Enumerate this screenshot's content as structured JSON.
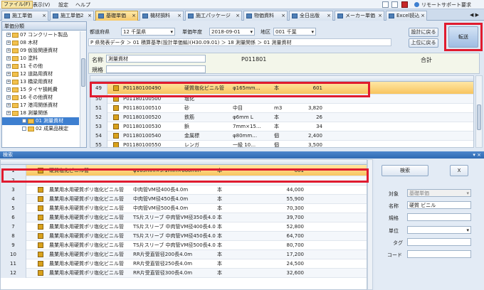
{
  "menu": {
    "file": "ファイル(F)",
    "view": "表示(V)",
    "settings": "設定",
    "help": "ヘルプ",
    "support": "リモートサポート要求"
  },
  "tabs": [
    "施工単価",
    "施工単価2",
    "基礎単価",
    "機材損料",
    "施工パッケージ",
    "物価資料",
    "全日出版",
    "メーカー単価",
    "Excel読込"
  ],
  "tab_close": "×",
  "tree": {
    "header": "単価分類",
    "items": [
      {
        "label": "07 コンクリート製品",
        "indent": 1
      },
      {
        "label": "08 木材",
        "indent": 1
      },
      {
        "label": "09 仮設関連資材",
        "indent": 1
      },
      {
        "label": "10 塗料",
        "indent": 1
      },
      {
        "label": "11 その他",
        "indent": 1
      },
      {
        "label": "12 道路用資材",
        "indent": 1
      },
      {
        "label": "13 橋梁用資材",
        "indent": 1
      },
      {
        "label": "15 タイヤ損耗費",
        "indent": 1
      },
      {
        "label": "16 その他資材",
        "indent": 1
      },
      {
        "label": "17 港湾関係資材",
        "indent": 1
      },
      {
        "label": "18 測量関係",
        "indent": 1
      },
      {
        "label": "01 測量資材",
        "indent": 2
      },
      {
        "label": "02 成果品検定",
        "indent": 2
      }
    ]
  },
  "filter": {
    "pref_label": "都道府県",
    "pref_value": "12 千葉県",
    "year_label": "単価年度",
    "year_value": "2018-09-01",
    "area_label": "地区",
    "area_value": "001 千葉",
    "path": "P 県発表データ ＞ 01 積算基準(設計単価編)(H30.09.01) ＞ 18 測量関係 ＞ 01 測量資材",
    "btn_settings_back": "設計に戻る",
    "btn_up": "上位に戻る",
    "btn_transfer": "転送"
  },
  "info": {
    "name_label": "名称",
    "name_value": "測量資材",
    "code": "P011801",
    "spec_label": "規格",
    "total_label": "合計"
  },
  "top_rows": [
    {
      "n": "49",
      "code": "P01180100490",
      "name": "硬質塩化ビニル管",
      "spec": "φ165mm…",
      "unit": "本",
      "price": "601"
    },
    {
      "n": "50",
      "code": "P01180100500",
      "name": "塩化",
      "spec": "",
      "unit": "",
      "price": ""
    },
    {
      "n": "51",
      "code": "P01180100510",
      "name": "砂",
      "spec": "中目",
      "unit": "m3",
      "price": "3,820"
    },
    {
      "n": "52",
      "code": "P01180100520",
      "name": "鉄筋",
      "spec": "φ6mm L",
      "unit": "本",
      "price": "26"
    },
    {
      "n": "53",
      "code": "P01180100530",
      "name": "鋲",
      "spec": "7mm×15…",
      "unit": "本",
      "price": "34"
    },
    {
      "n": "54",
      "code": "P01180100540",
      "name": "金属標",
      "spec": "φ80mm…",
      "unit": "個",
      "price": "2,400"
    },
    {
      "n": "55",
      "code": "P01180100550",
      "name": "レンガ",
      "spec": "一級 10…",
      "unit": "個",
      "price": "3,500"
    }
  ],
  "search": {
    "title": "検索",
    "btn_search": "検索",
    "btn_close": "X",
    "target_label": "対象",
    "target_value": "基礎単価",
    "name_label": "名称",
    "name_value": "硬質 ビニル",
    "spec_label": "規格",
    "unit_label": "単位",
    "tag_label": "タグ",
    "code_label": "コード"
  },
  "results": [
    {
      "n": "1",
      "name": "硬質塩化ビニル管",
      "spec": "φ165mm×5.1mm×660mm",
      "unit": "本",
      "price": "601"
    },
    {
      "n": "2",
      "name": "",
      "spec": "",
      "unit": "",
      "price": ""
    },
    {
      "n": "3",
      "name": "農業用水用硬質ポリ塩化ビニル管",
      "spec": "中肉管VM径400長4.0m",
      "unit": "本",
      "price": "44,000"
    },
    {
      "n": "4",
      "name": "農業用水用硬質ポリ塩化ビニル管",
      "spec": "中肉管VM径450長4.0m",
      "unit": "本",
      "price": "55,900"
    },
    {
      "n": "5",
      "name": "農業用水用硬質ポリ塩化ビニル管",
      "spec": "中肉管VM径500長4.0m",
      "unit": "本",
      "price": "70,300"
    },
    {
      "n": "6",
      "name": "農業用水用硬質ポリ塩化ビニル管",
      "spec": "TS片スリーブ 中肉管VM径350長4.0m",
      "unit": "本",
      "price": "39,700"
    },
    {
      "n": "7",
      "name": "農業用水用硬質ポリ塩化ビニル管",
      "spec": "TS片スリーブ 中肉管VM径400長4.0m",
      "unit": "本",
      "price": "52,800"
    },
    {
      "n": "8",
      "name": "農業用水用硬質ポリ塩化ビニル管",
      "spec": "TS片スリーブ 中肉管VM径450長4.0m",
      "unit": "本",
      "price": "64,700"
    },
    {
      "n": "9",
      "name": "農業用水用硬質ポリ塩化ビニル管",
      "spec": "TS片スリーブ 中肉管VM径500長4.0m",
      "unit": "本",
      "price": "80,700"
    },
    {
      "n": "10",
      "name": "農業用水用硬質ポリ塩化ビニル管",
      "spec": "RR片受直管径200長4.0m",
      "unit": "本",
      "price": "17,200"
    },
    {
      "n": "11",
      "name": "農業用水用硬質ポリ塩化ビニル管",
      "spec": "RR片受直管径250長4.0m",
      "unit": "本",
      "price": "24,500"
    },
    {
      "n": "12",
      "name": "農業用水用硬質ポリ塩化ビニル管",
      "spec": "RR片受直管径300長4.0m",
      "unit": "本",
      "price": "32,600"
    }
  ],
  "colors": {
    "highlight": "#e01b2f",
    "selection": "#3d7fd0",
    "accent": "#f8c45e"
  }
}
